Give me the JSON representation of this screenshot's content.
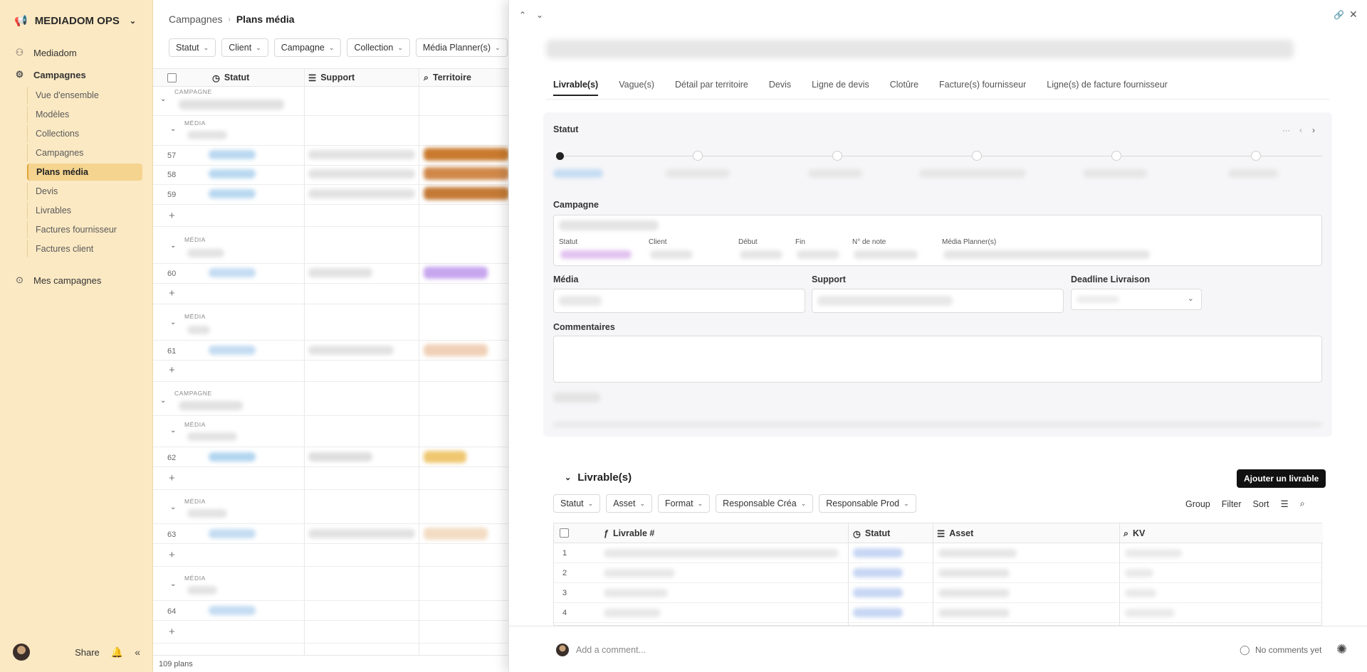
{
  "sidebar": {
    "workspace": "MEDIADOM OPS",
    "nav": [
      {
        "label": "Mediadom",
        "icon": "users-icon"
      },
      {
        "label": "Campagnes",
        "icon": "gear-users-icon"
      },
      {
        "label": "Mes campagnes",
        "icon": "play-circle-icon"
      }
    ],
    "sub": [
      "Vue d'ensemble",
      "Modèles",
      "Collections",
      "Campagnes",
      "Plans média",
      "Devis",
      "Livrables",
      "Factures fournisseur",
      "Factures client"
    ],
    "active_sub": "Plans média",
    "share": "Share"
  },
  "main": {
    "breadcrumb": [
      "Campagnes",
      "Plans média"
    ],
    "filters": [
      "Statut",
      "Client",
      "Campagne",
      "Collection",
      "Média Planner(s)"
    ],
    "columns": [
      "Statut",
      "Support",
      "Territoire"
    ],
    "group_labels": {
      "campaign": "CAMPAGNE",
      "media": "MÉDIA"
    },
    "rows": [
      "57",
      "58",
      "59",
      "60",
      "61",
      "62",
      "63",
      "64"
    ],
    "count": "109 plans"
  },
  "panel": {
    "tabs": [
      "Livrable(s)",
      "Vague(s)",
      "Détail par territoire",
      "Devis",
      "Ligne de devis",
      "Clotûre",
      "Facture(s) fournisseur",
      "Ligne(s) de facture fournisseur"
    ],
    "statut_label": "Statut",
    "campagne_label": "Campagne",
    "campagne_fields": [
      "Statut",
      "Client",
      "Début",
      "Fin",
      "N° de note",
      "Média Planner(s)"
    ],
    "media_label": "Média",
    "support_label": "Support",
    "deadline_label": "Deadline Livraison",
    "commentaires_label": "Commentaires",
    "livrables_title": "Livrable(s)",
    "add_livrable": "Ajouter un livrable",
    "livrable_filters": [
      "Statut",
      "Asset",
      "Format",
      "Responsable Créa",
      "Responsable Prod"
    ],
    "tools": [
      "Group",
      "Filter",
      "Sort"
    ],
    "sub_columns": [
      "Livrable #",
      "Statut",
      "Asset",
      "KV"
    ],
    "sub_rows": [
      "1",
      "2",
      "3",
      "4"
    ],
    "comment_placeholder": "Add a comment...",
    "no_comments": "No comments yet"
  }
}
